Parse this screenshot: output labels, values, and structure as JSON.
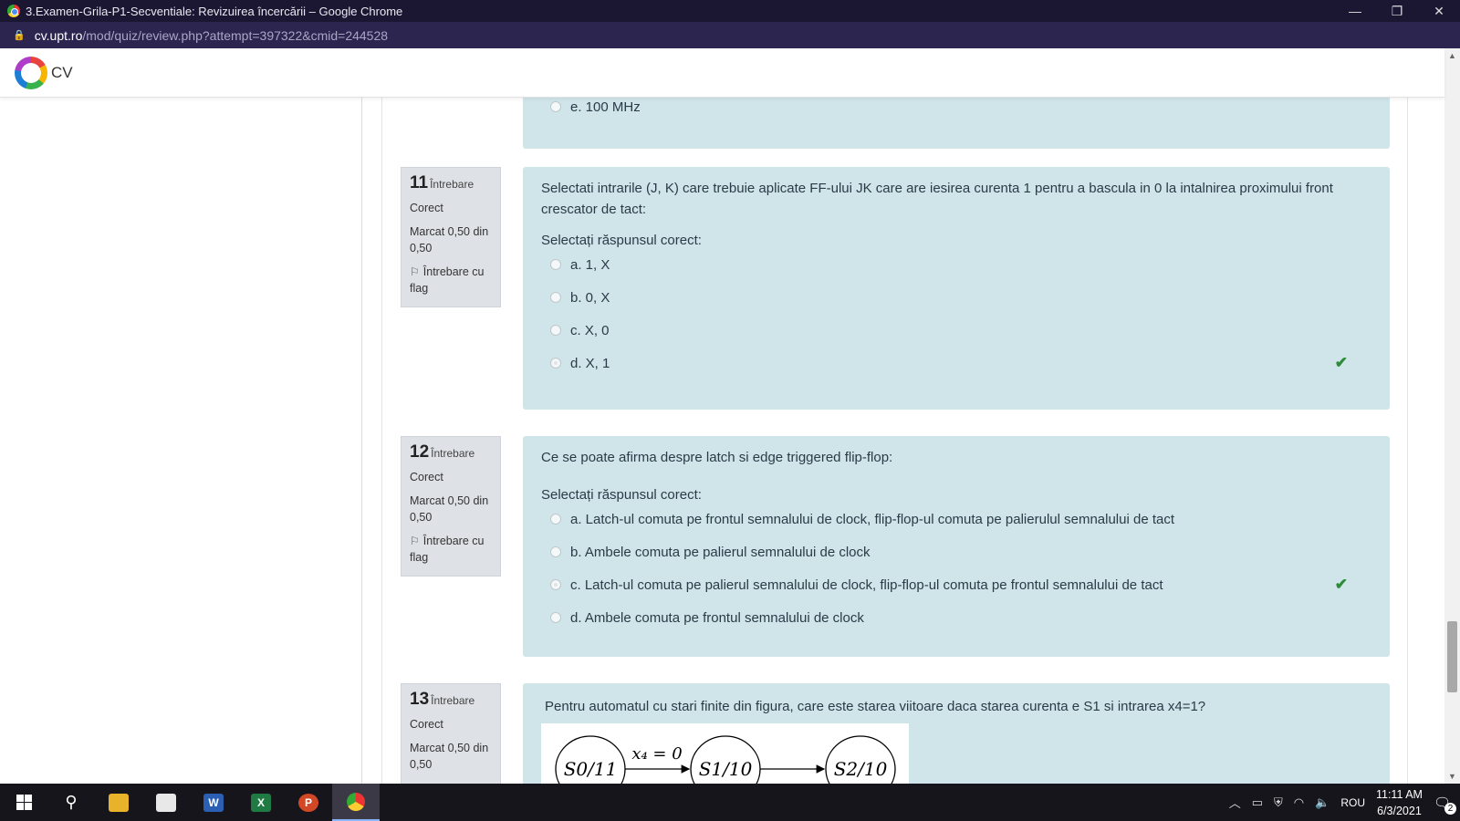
{
  "window": {
    "title": "3.Examen-Grila-P1-Secventiale: Revizuirea încercării – Google Chrome",
    "minimize": "—",
    "maximize": "❐",
    "close": "✕"
  },
  "address": {
    "domain": "cv.upt.ro",
    "path": "/mod/quiz/review.php?attempt=397322&cmid=244528"
  },
  "site": {
    "name": "CV"
  },
  "prev_option": {
    "label": "e. 100 MHz"
  },
  "questions": [
    {
      "number": "11",
      "word": "Întrebare",
      "status": "Corect",
      "mark": "Marcat 0,50 din 0,50",
      "flag": "Întrebare cu flag",
      "text": "Selectati intrarile (J, K) care trebuie aplicate FF-ului JK care are iesirea curenta 1 pentru a bascula in 0 la intalnirea proximului front crescator de tact:",
      "prompt": "Selectați răspunsul corect:",
      "options": [
        "a. 1, X",
        "b. 0, X",
        "c. X, 0",
        "d. X, 1"
      ]
    },
    {
      "number": "12",
      "word": "Întrebare",
      "status": "Corect",
      "mark": "Marcat 0,50 din 0,50",
      "flag": "Întrebare cu flag",
      "text": "Ce se poate afirma despre latch si edge triggered flip-flop:",
      "prompt": "Selectați răspunsul corect:",
      "options": [
        "a. Latch-ul comuta pe frontul semnalului de clock, flip-flop-ul comuta pe palierulul semnalului de tact",
        "b. Ambele comuta pe palierul semnalului de clock",
        "c. Latch-ul comuta pe palierul semnalului de clock, flip-flop-ul comuta pe frontul semnalului de tact",
        "d. Ambele comuta pe frontul semnalului de clock"
      ]
    },
    {
      "number": "13",
      "word": "Întrebare",
      "status": "Corect",
      "mark": "Marcat 0,50 din 0,50",
      "text": "Pentru automatul cu stari finite din figura, care este starea viitoare daca starea curenta e S1 si intrarea x4=1?",
      "diagram": {
        "states": [
          "S0/11",
          "S1/10",
          "S2/10"
        ],
        "transition_label": "x₄ = 0"
      }
    }
  ],
  "taskbar": {
    "language": "ROU",
    "time": "11:11 AM",
    "date": "6/3/2021",
    "notifications": "2"
  },
  "colors": {
    "question_bg": "#cfe5ea",
    "info_bg": "#dee2e6",
    "correct_tick": "#2e8b3a"
  }
}
